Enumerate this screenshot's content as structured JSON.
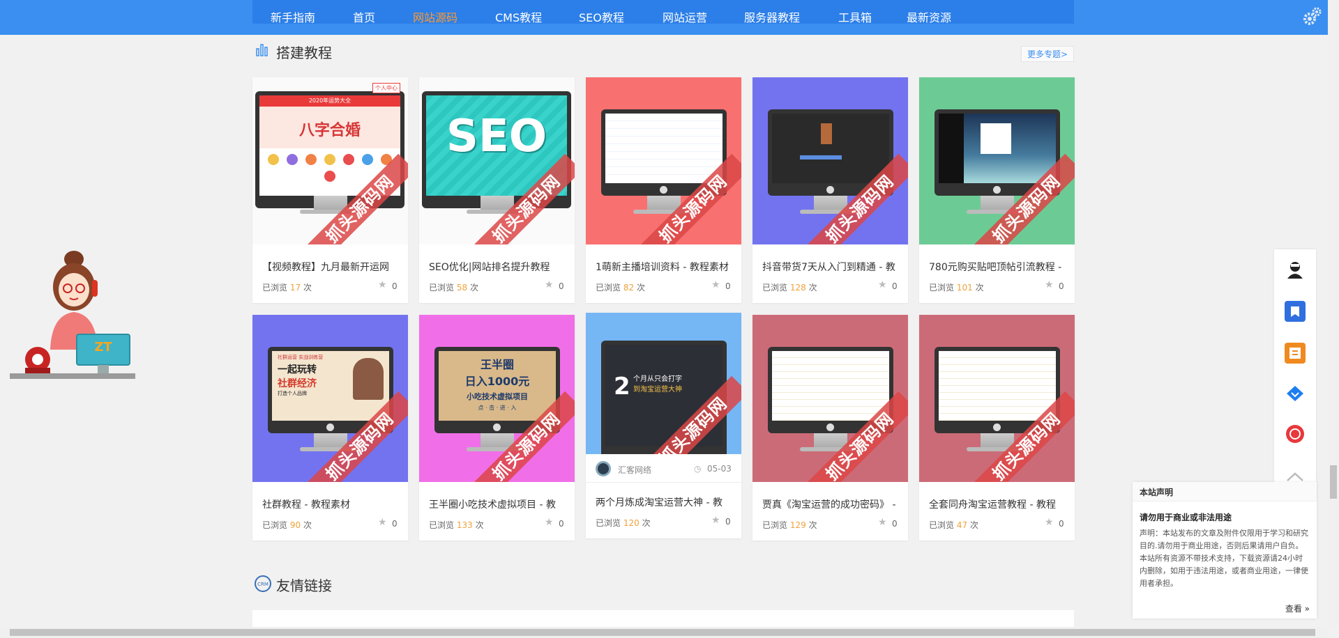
{
  "nav": {
    "items": [
      "新手指南",
      "首页",
      "网站源码",
      "CMS教程",
      "SEO教程",
      "网站运营",
      "服务器教程",
      "工具箱",
      "最新资源"
    ],
    "active_index": 2
  },
  "section1": {
    "title": "搭建教程",
    "more": "更多专题>"
  },
  "section2": {
    "title": "友情链接"
  },
  "watermark": "抓头源码网",
  "views_prefix": "已浏览",
  "views_suffix": "次",
  "cards": [
    {
      "title": "【视频教程】九月最新开运网",
      "views": "17",
      "favs": "0",
      "bg": "#ffffff"
    },
    {
      "title": "SEO优化|网站排名提升教程",
      "views": "58",
      "favs": "0",
      "bg": "#ffffff"
    },
    {
      "title": "1萌新主播培训资料 - 教程素材",
      "views": "82",
      "favs": "0",
      "bg": "#f97070"
    },
    {
      "title": "抖音带货7天从入门到精通 - 教",
      "views": "128",
      "favs": "0",
      "bg": "#7373f0"
    },
    {
      "title": "780元购买贴吧顶帖引流教程 -",
      "views": "101",
      "favs": "0",
      "bg": "#6ccb95"
    },
    {
      "title": "社群教程 - 教程素材",
      "views": "90",
      "favs": "0",
      "bg": "#7373f0"
    },
    {
      "title": "王半圈小吃技术虚拟项目 - 教",
      "views": "133",
      "favs": "0",
      "bg": "#f06fe8"
    },
    {
      "title": "两个月炼成淘宝运营大神 - 教",
      "views": "120",
      "favs": "0",
      "bg": "#75b6f5",
      "author": "汇客网络",
      "date": "05-03"
    },
    {
      "title": "贾真《淘宝运营的成功密码》 -",
      "views": "129",
      "favs": "0",
      "bg": "#cc6b78"
    },
    {
      "title": "全套同舟淘宝运营教程 - 教程",
      "views": "47",
      "favs": "0",
      "bg": "#cc6b78"
    }
  ],
  "screens": {
    "card1_banner": "2020年运势大全",
    "card1_headline": "八字合婚",
    "card1_tag": "个人中心",
    "card2_big": "SEO",
    "card6_line1": "社群运营 实战训练营",
    "card6_line2": "一起玩转",
    "card6_line3": "社群经济",
    "card6_line4": "打造个人品牌",
    "card7_line1": "王半圈",
    "card7_line2": "日入1000元",
    "card7_line3": "小吃技术虚拟项目",
    "card7_line4": "点 · 击 · 进 · 入",
    "card8_line1": "个月从只会打字",
    "card8_line2": "到淘宝运营大神",
    "card8_num": "2"
  },
  "mascot": {
    "logo": "ZT"
  },
  "notice": {
    "title": "本站声明",
    "subtitle": "请勿用于商业或非法用途",
    "body": "声明：本站发布的文章及附件仅限用于学习和研究目的.请勿用于商业用途，否则后果请用户自负。 本站所有资源不带技术支持，下载资源请24小时内删除，如用于违法用途，或者商业用途，一律使用者承担。",
    "more": "查看 »"
  },
  "colors": {
    "nav_bg": "#3a8ff0",
    "accent": "#ff9a2e",
    "views": "#f0a23a"
  }
}
